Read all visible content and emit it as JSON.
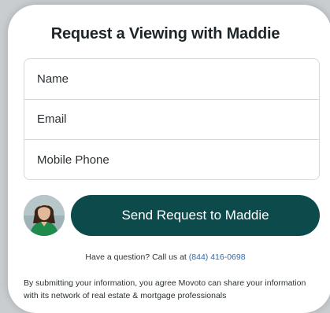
{
  "form": {
    "title": "Request a Viewing with Maddie",
    "name_placeholder": "Name",
    "email_placeholder": "Email",
    "phone_placeholder": "Mobile Phone"
  },
  "agent": {
    "avatar_icon": "agent-photo"
  },
  "actions": {
    "send_label": "Send Request to Maddie",
    "button_color": "#0d4a4c"
  },
  "help": {
    "question_text": "Have a question? Call us at",
    "phone_number": "(844) 416-0698",
    "phone_color": "#2f6aa8"
  },
  "legal": {
    "disclaimer": "By submitting your information, you agree Movoto can share your information with its network of real estate & mortgage professionals"
  }
}
